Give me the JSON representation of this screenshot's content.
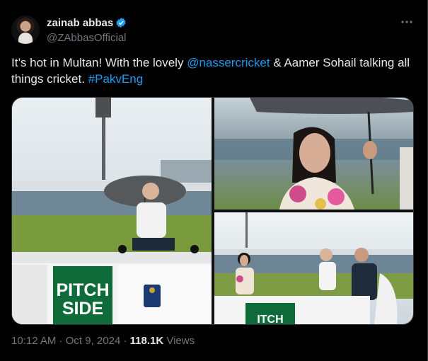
{
  "author": {
    "name": "zainab abbas",
    "handle": "@ZAbbasOfficial"
  },
  "tweet": {
    "text_1": "It’s hot in Multan! With the lovely ",
    "mention": "@nassercricket",
    "text_2": " & Aamer Sohail talking all things cricket. ",
    "hashtag": "#PakvEng"
  },
  "media": {
    "image1_sign": [
      "PITCH",
      "SIDE"
    ],
    "image3_sign": "ITCH"
  },
  "footer": {
    "time": "10:12 AM",
    "separator": " · ",
    "date": "Oct 9, 2024",
    "views_count": "118.1K",
    "views_label": " Views"
  },
  "colors": {
    "accent": "#1d9bf0",
    "background": "#000000",
    "muted": "#71767b"
  }
}
